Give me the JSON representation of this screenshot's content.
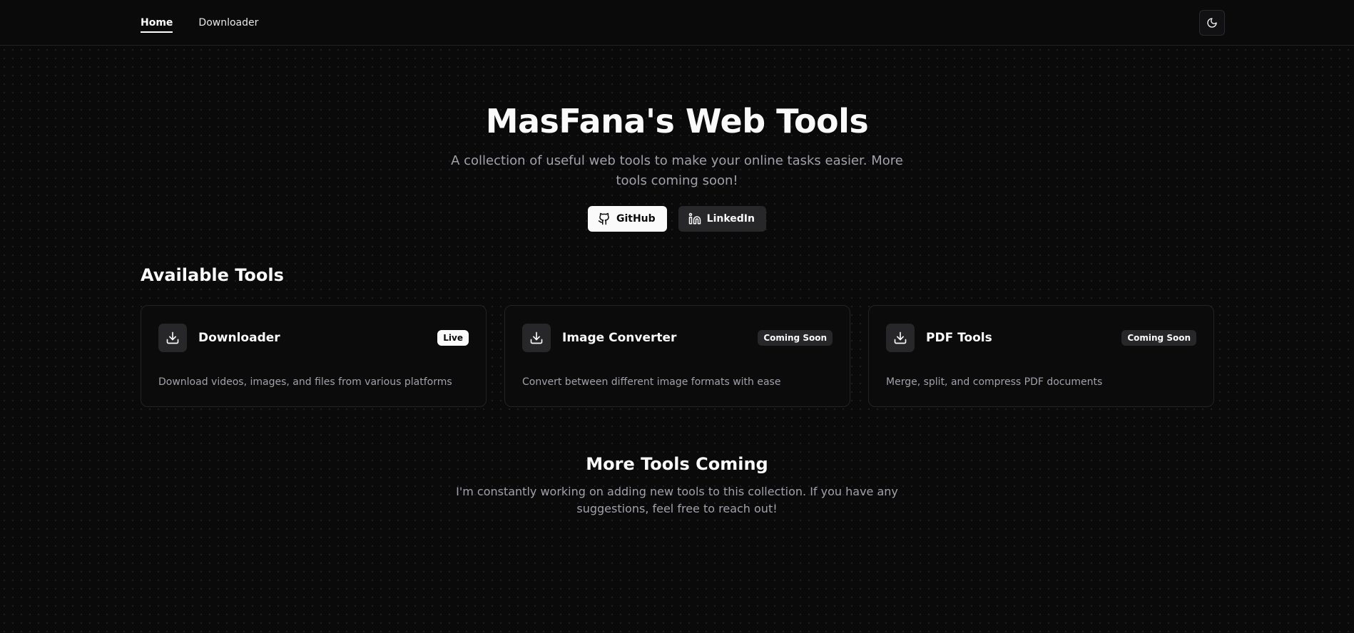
{
  "nav": {
    "items": [
      {
        "label": "Home",
        "active": true
      },
      {
        "label": "Downloader",
        "active": false
      }
    ],
    "theme_toggle_icon": "moon-icon"
  },
  "hero": {
    "title": "MasFana's Web Tools",
    "subtitle": "A collection of useful web tools to make your online tasks easier. More tools coming soon!",
    "buttons": [
      {
        "label": "GitHub",
        "icon": "github-icon"
      },
      {
        "label": "LinkedIn",
        "icon": "linkedin-icon"
      }
    ]
  },
  "tools": {
    "heading": "Available Tools",
    "items": [
      {
        "title": "Downloader",
        "badge": "Live",
        "description": "Download videos, images, and files from various platforms",
        "icon": "download-icon"
      },
      {
        "title": "Image Converter",
        "badge": "Coming Soon",
        "description": "Convert between different image formats with ease",
        "icon": "download-icon"
      },
      {
        "title": "PDF Tools",
        "badge": "Coming Soon",
        "description": "Merge, split, and compress PDF documents",
        "icon": "download-icon"
      }
    ]
  },
  "more": {
    "heading": "More Tools Coming",
    "text": "I'm constantly working on adding new tools to this collection. If you have any suggestions, feel free to reach out!"
  },
  "colors": {
    "background": "#0a0a0b",
    "foreground": "#fafafa",
    "muted": "#a1a1aa",
    "secondary": "#27272a"
  }
}
